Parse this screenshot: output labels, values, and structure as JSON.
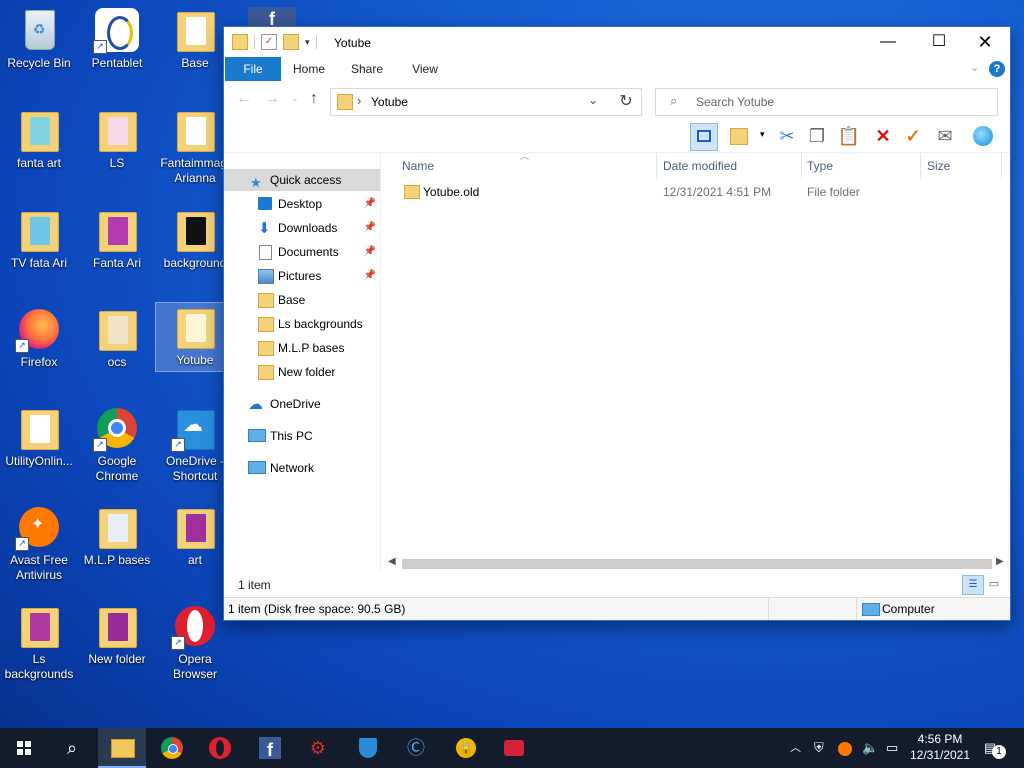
{
  "desktop": {
    "icons": [
      {
        "label": "Recycle Bin"
      },
      {
        "label": "Pentablet"
      },
      {
        "label": "Base"
      },
      {
        "label": "fanta art"
      },
      {
        "label": "LS"
      },
      {
        "label": "Fantaimmagi Arianna"
      },
      {
        "label": "TV fata Ari"
      },
      {
        "label": "Fanta Ari"
      },
      {
        "label": "background"
      },
      {
        "label": "Firefox"
      },
      {
        "label": "ocs"
      },
      {
        "label": "Yotube"
      },
      {
        "label": "UtilityOnlin..."
      },
      {
        "label": "Google Chrome"
      },
      {
        "label": "OneDrive - Shortcut"
      },
      {
        "label": "Avast Free Antivirus"
      },
      {
        "label": "M.L.P bases"
      },
      {
        "label": "art"
      },
      {
        "label": "Ls backgrounds"
      },
      {
        "label": "New folder"
      },
      {
        "label": "Opera Browser"
      }
    ]
  },
  "explorer": {
    "title": "Yotube",
    "ribbon_tabs": [
      "File",
      "Home",
      "Share",
      "View"
    ],
    "address": {
      "path": "Yotube",
      "separator": "›"
    },
    "search": {
      "placeholder": "Search Yotube"
    },
    "sidebar": {
      "quick_access": "Quick access",
      "items": [
        {
          "label": "Desktop",
          "pinned": true
        },
        {
          "label": "Downloads",
          "pinned": true
        },
        {
          "label": "Documents",
          "pinned": true
        },
        {
          "label": "Pictures",
          "pinned": true
        },
        {
          "label": "Base",
          "pinned": false
        },
        {
          "label": "Ls backgrounds",
          "pinned": false
        },
        {
          "label": "M.L.P bases",
          "pinned": false
        },
        {
          "label": "New folder",
          "pinned": false
        }
      ],
      "onedrive": "OneDrive",
      "this_pc": "This PC",
      "network": "Network"
    },
    "columns": {
      "name": "Name",
      "date": "Date modified",
      "type": "Type",
      "size": "Size"
    },
    "files": [
      {
        "name": "Yotube.old",
        "date": "12/31/2021 4:51 PM",
        "type": "File folder",
        "size": ""
      }
    ],
    "item_count": "1 item",
    "status": {
      "left": "1 item (Disk free space: 90.5 GB)",
      "right": "Computer"
    }
  },
  "taskbar": {
    "time": "4:56 PM",
    "date": "12/31/2021",
    "notification_count": "1"
  },
  "colors": {
    "accent": "#1979ca",
    "folder": "#f3d27a",
    "taskbar": "#121c2b"
  }
}
